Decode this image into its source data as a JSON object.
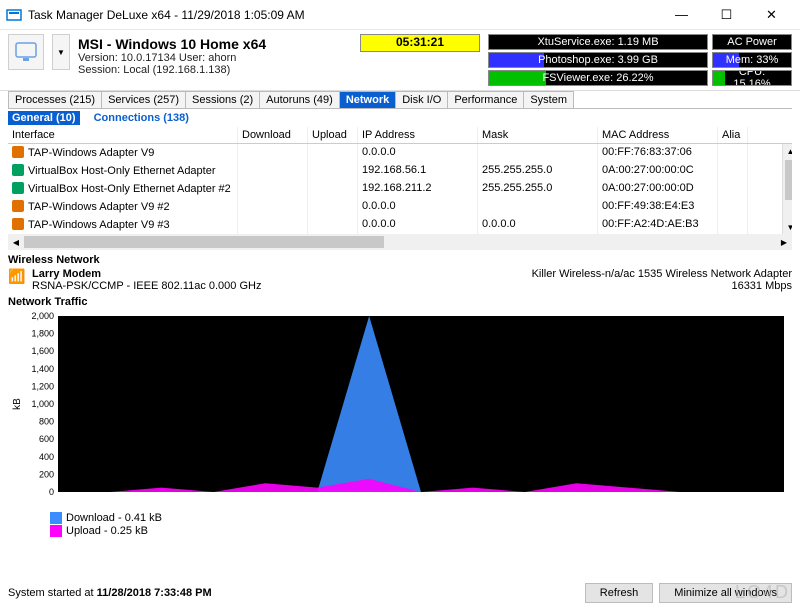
{
  "window": {
    "title": "Task Manager DeLuxe x64 - 11/29/2018 1:05:09 AM"
  },
  "header": {
    "system_name": "MSI - Windows 10 Home x64",
    "version_user": "Version: 10.0.17134    User: ahorn",
    "session": "Session: Local (192.168.1.138)",
    "uptime": "05:31:21"
  },
  "stats": [
    {
      "big": "XtuService.exe: 1.19 MB",
      "big_fill": 0,
      "big_color": "#000",
      "sm": "AC Power",
      "sm_fill": 0,
      "sm_color": "#000"
    },
    {
      "big": "Photoshop.exe: 3.99 GB",
      "big_fill": 25,
      "big_color": "#3030ff",
      "sm": "Mem: 33%",
      "sm_fill": 33,
      "sm_color": "#3030ff"
    },
    {
      "big": "FSViewer.exe: 26.22%",
      "big_fill": 26,
      "big_color": "#00c000",
      "sm": "CPU: 15.16%",
      "sm_fill": 15,
      "sm_color": "#00c000"
    }
  ],
  "tabs": [
    "Processes (215)",
    "Services (257)",
    "Sessions (2)",
    "Autoruns (49)",
    "Network",
    "Disk I/O",
    "Performance",
    "System"
  ],
  "active_tab": "Network",
  "toolbar": {
    "general": "General (10)",
    "connections": "Connections (138)"
  },
  "columns": {
    "iface": "Interface",
    "dl": "Download",
    "ul": "Upload",
    "ip": "IP Address",
    "mask": "Mask",
    "mac": "MAC Address",
    "alias": "Alia"
  },
  "rows": [
    {
      "ic": "tap",
      "name": "TAP-Windows Adapter V9",
      "ip": "0.0.0.0",
      "mask": "",
      "mac": "00:FF:76:83:37:06"
    },
    {
      "ic": "vb",
      "name": "VirtualBox Host-Only Ethernet Adapter",
      "ip": "192.168.56.1",
      "mask": "255.255.255.0",
      "mac": "0A:00:27:00:00:0C"
    },
    {
      "ic": "vb",
      "name": "VirtualBox Host-Only Ethernet Adapter #2",
      "ip": "192.168.211.2",
      "mask": "255.255.255.0",
      "mac": "0A:00:27:00:00:0D"
    },
    {
      "ic": "tap",
      "name": "TAP-Windows Adapter V9 #2",
      "ip": "0.0.0.0",
      "mask": "",
      "mac": "00:FF:49:38:E4:E3"
    },
    {
      "ic": "tap",
      "name": "TAP-Windows Adapter V9 #3",
      "ip": "0.0.0.0",
      "mask": "0.0.0.0",
      "mac": "00:FF:A2:4D:AE:B3"
    }
  ],
  "wireless": {
    "heading": "Wireless Network",
    "name": "Larry Modem",
    "proto": "RSNA-PSK/CCMP - IEEE 802.11ac 0.000 GHz",
    "adapter": "Killer Wireless-n/a/ac 1535 Wireless Network Adapter",
    "speed": "16331 Mbps"
  },
  "traffic_heading": "Network Traffic",
  "legend": {
    "download": "Download - 0.41 kB",
    "upload": "Upload - 0.25 kB"
  },
  "footer": {
    "prefix": "System started at ",
    "time": "11/28/2018 7:33:48 PM",
    "refresh": "Refresh",
    "minimize": "Minimize all windows"
  },
  "watermark": "LO4D",
  "chart_data": {
    "type": "line",
    "ylabel": "kB",
    "ylim": [
      0,
      2000
    ],
    "yticks": [
      0,
      200,
      400,
      600,
      800,
      1000,
      1200,
      1400,
      1600,
      1800,
      2000
    ],
    "series": [
      {
        "name": "Download",
        "color": "#3a8cff",
        "values": [
          0,
          0,
          0,
          0,
          0,
          0,
          2000,
          0,
          0,
          0,
          0,
          0,
          0,
          0,
          0.41
        ]
      },
      {
        "name": "Upload",
        "color": "#ff00ff",
        "values": [
          0,
          0,
          50,
          0,
          100,
          50,
          150,
          0,
          50,
          0,
          100,
          50,
          0,
          0,
          0.25
        ]
      }
    ]
  }
}
